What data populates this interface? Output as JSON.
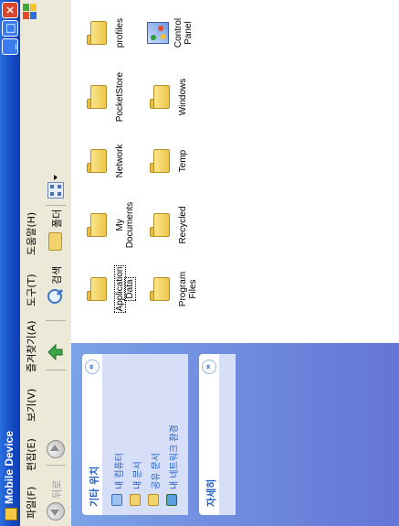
{
  "window": {
    "title": "Mobile Device",
    "min_glyph": "_",
    "max_glyph": "□",
    "close_glyph": "×"
  },
  "menu": [
    "파일(F)",
    "편집(E)",
    "보기(V)",
    "즐겨찾기(A)",
    "도구(T)",
    "도움말(H)"
  ],
  "toolbar": {
    "back_label": "뒤로",
    "search_label": "검색",
    "folders_label": "폴더"
  },
  "taskpane": {
    "other_places": {
      "title": "기타 위치",
      "chevron": "«",
      "links": [
        {
          "label": "내 컴퓨터",
          "icon": "my-computer-icon"
        },
        {
          "label": "내 문서",
          "icon": "my-documents-icon"
        },
        {
          "label": "공유 문서",
          "icon": "shared-documents-icon"
        },
        {
          "label": "내 네트워크 환경",
          "icon": "my-network-places-icon"
        }
      ]
    },
    "details": {
      "title": "자세히",
      "chevron": "»"
    }
  },
  "items": [
    {
      "name": "Application Data",
      "lines": [
        "Application",
        "Data"
      ],
      "selected": true
    },
    {
      "name": "Program Files",
      "lines": [
        "Program",
        "Files"
      ]
    },
    {
      "name": "My Documents",
      "lines": [
        "My",
        "Documents"
      ]
    },
    {
      "name": "Recycled",
      "lines": [
        "Recycled"
      ]
    },
    {
      "name": "Network",
      "lines": [
        "Network"
      ]
    },
    {
      "name": "Temp",
      "lines": [
        "Temp"
      ]
    },
    {
      "name": "PocketStore",
      "lines": [
        "PocketStore"
      ]
    },
    {
      "name": "Windows",
      "lines": [
        "Windows"
      ]
    },
    {
      "name": "profiles",
      "lines": [
        "profiles"
      ]
    },
    {
      "name": "Control Panel",
      "lines": [
        "Control",
        "Panel"
      ],
      "icon": "control-panel-icon"
    }
  ],
  "colors": {
    "titlebar": "#1549c4",
    "taskpane": "#7ba2e7",
    "link": "#215dc6",
    "folder": "#eec54b"
  }
}
